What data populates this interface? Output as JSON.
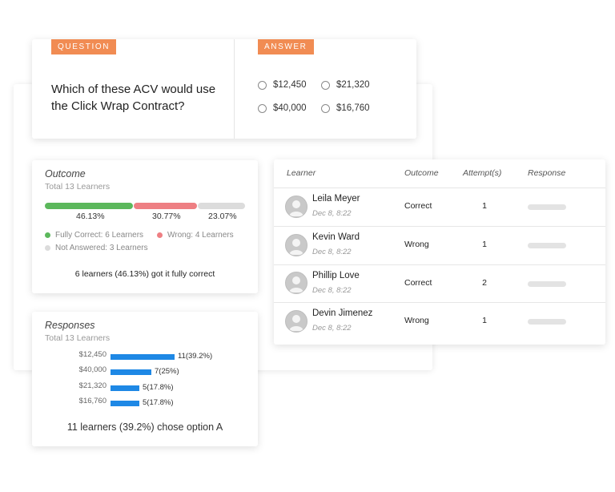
{
  "question": {
    "tag": "QUESTION",
    "text": "Which of these ACV would use the Click Wrap Contract?"
  },
  "answer": {
    "tag": "ANSWER",
    "options": [
      "$12,450",
      "$21,320",
      "$40,000",
      "$16,760"
    ]
  },
  "outcome": {
    "title": "Outcome",
    "subtitle": "Total 13 Learners",
    "segments": [
      {
        "pct_label": "46.13%",
        "color": "#5cb85c"
      },
      {
        "pct_label": "30.77%",
        "color": "#ee7f83"
      },
      {
        "pct_label": "23.07%",
        "color": "#dcdcdc"
      }
    ],
    "legend": {
      "correct": "Fully Correct: 6 Learners",
      "wrong": "Wrong: 4 Learners",
      "not_answered": "Not Answered: 3 Learners"
    },
    "summary": "6 learners (46.13%) got it fully correct"
  },
  "responses": {
    "title": "Responses",
    "subtitle": "Total 13 Learners",
    "bars": [
      {
        "label": "$12,450",
        "value": 11,
        "value_label": "11(39.2%)"
      },
      {
        "label": "$40,000",
        "value": 7,
        "value_label": "7(25%)"
      },
      {
        "label": "$21,320",
        "value": 5,
        "value_label": "5(17.8%)"
      },
      {
        "label": "$16,760",
        "value": 5,
        "value_label": "5(17.8%)"
      }
    ],
    "summary": "11 learners (39.2%) chose option A"
  },
  "table": {
    "headers": {
      "learner": "Learner",
      "outcome": "Outcome",
      "attempts": "Attempt(s)",
      "response": "Response"
    },
    "rows": [
      {
        "name": "Leila Meyer",
        "date": "Dec 8, 8:22",
        "outcome": "Correct",
        "attempts": "1"
      },
      {
        "name": "Kevin Ward",
        "date": "Dec 8, 8:22",
        "outcome": "Wrong",
        "attempts": "1"
      },
      {
        "name": "Phillip Love",
        "date": "Dec 8, 8:22",
        "outcome": "Correct",
        "attempts": "2"
      },
      {
        "name": "Devin Jimenez",
        "date": "Dec 8, 8:22",
        "outcome": "Wrong",
        "attempts": "1"
      }
    ]
  },
  "colors": {
    "accent_tag": "#f18c53",
    "bar_blue": "#1e88e5",
    "correct_green": "#5cb85c",
    "wrong_red": "#ee7f83",
    "not_answered_grey": "#dcdcdc"
  },
  "icons": {
    "avatar": "user-avatar-icon",
    "radio": "radio-button-icon"
  }
}
